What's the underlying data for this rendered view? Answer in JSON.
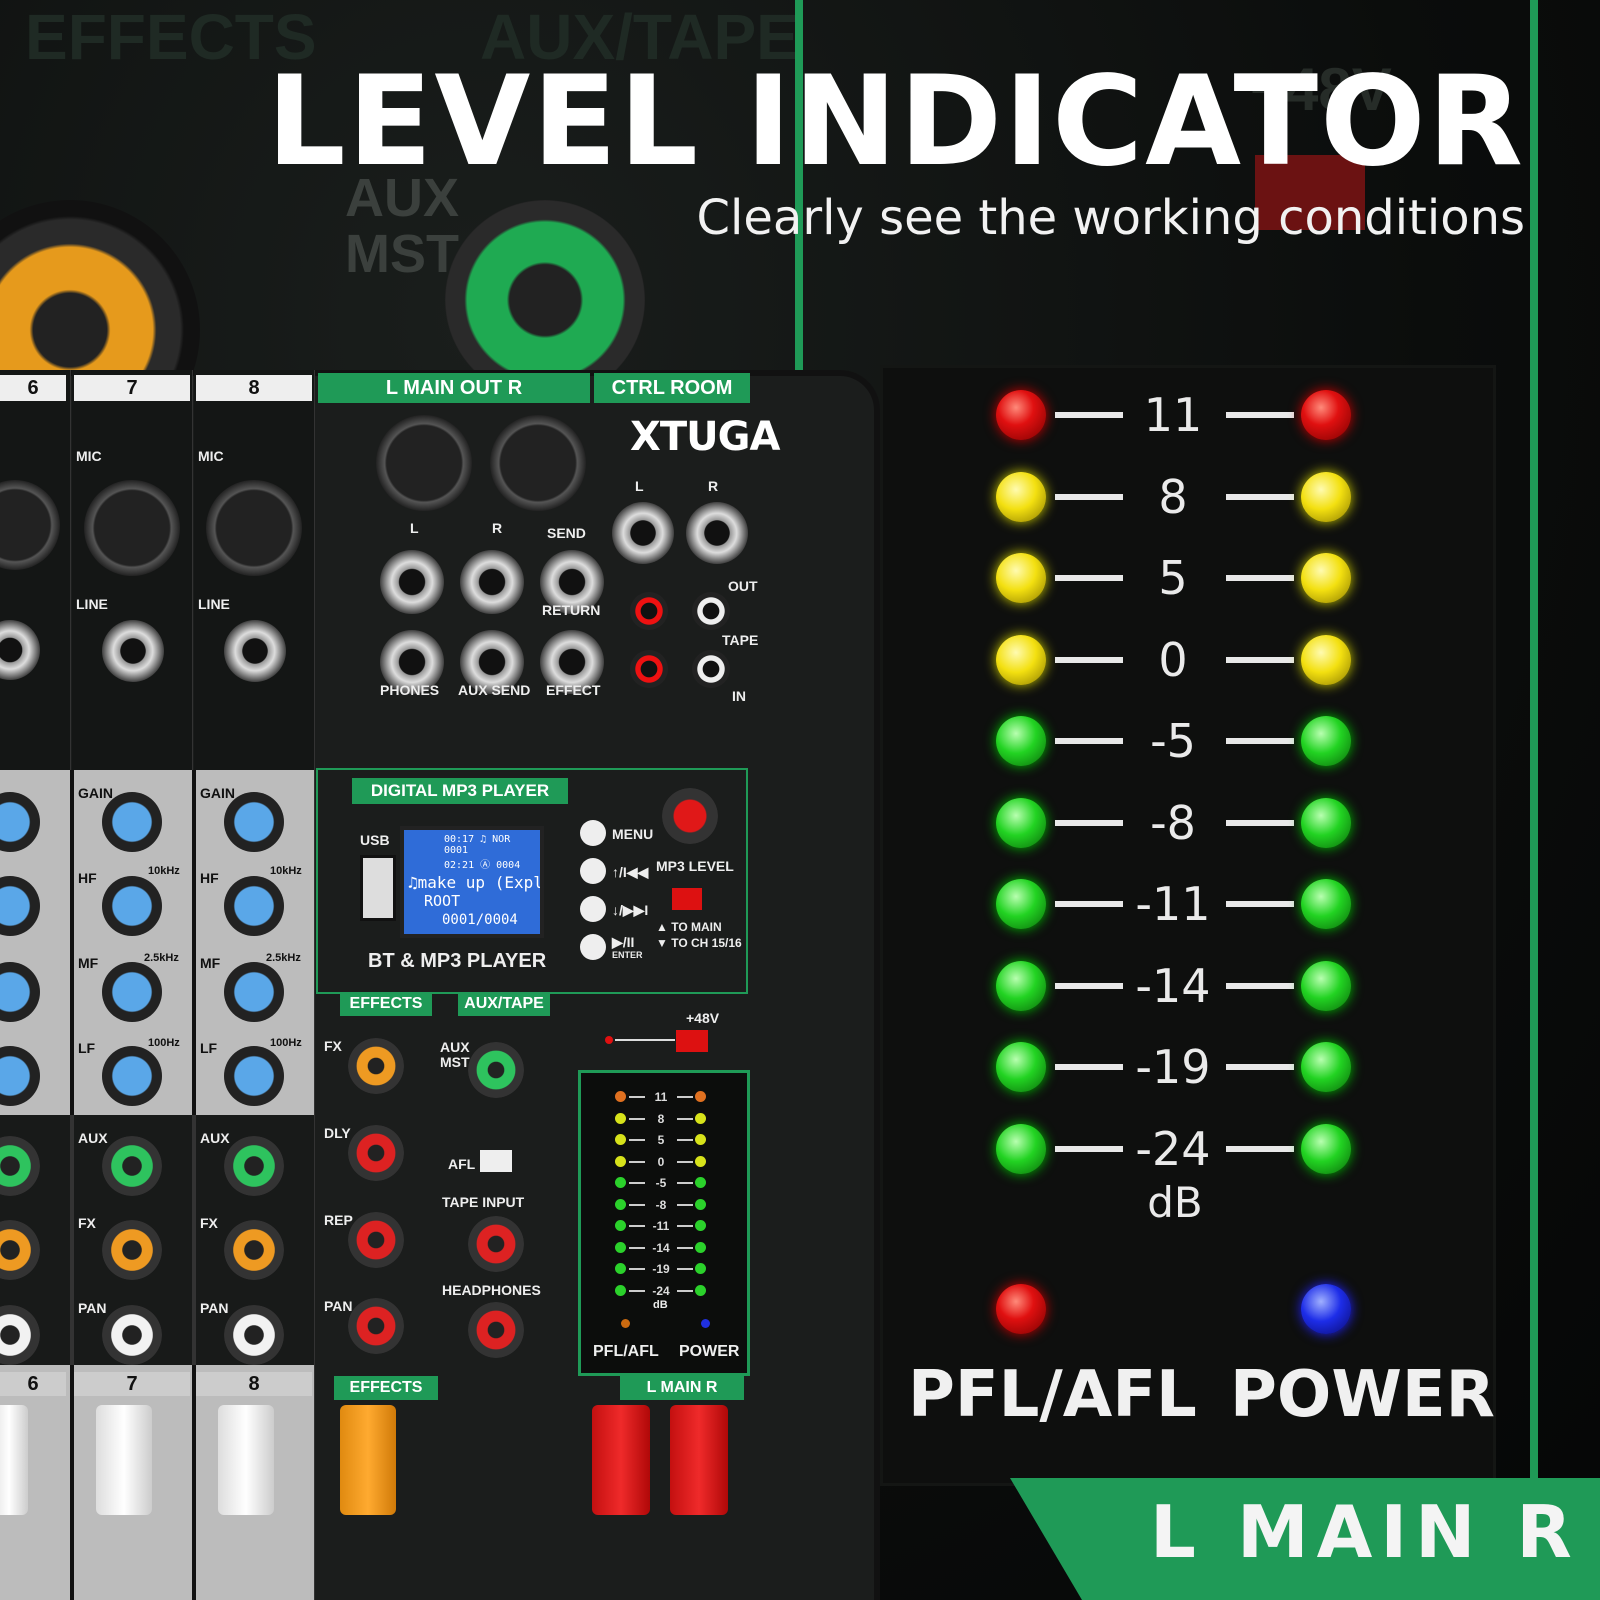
{
  "headline": "LEVEL INDICATOR",
  "subline": "Clearly see the working conditions",
  "background_text": {
    "effects": "EFFECTS",
    "aux_tape": "AUX/TAPE",
    "aux_mst": "AUX MST",
    "p48v": "+48V"
  },
  "mixer": {
    "channels": [
      "6",
      "7",
      "8"
    ],
    "main_out": "L  MAIN OUT  R",
    "ctrl_room": "CTRL ROOM",
    "brand": "XTUGA",
    "jack_labels": {
      "mic": "MIC",
      "line": "LINE",
      "l": "L",
      "r": "R",
      "send": "SEND",
      "return": "RETURN",
      "phones": "PHONES",
      "aux_send": "AUX SEND",
      "effect": "EFFECT",
      "out": "OUT",
      "tape": "TAPE",
      "in": "IN"
    },
    "mp3": {
      "title": "DIGITAL MP3 PLAYER",
      "usb": "USB",
      "lcd_line1": "00:17 ♫ NOR 0001",
      "lcd_line2": "02:21 Ⓐ 0004",
      "lcd_line3": "♫make up (Explic",
      "lcd_line4": "ROOT",
      "lcd_line5": "0001/0004",
      "bt_label": "BT & MP3 PLAYER",
      "menu": "MENU",
      "prev": "↑/I◀◀",
      "next": "↓/▶▶I",
      "play": "▶/II",
      "enter": "ENTER",
      "mp3_level": "MP3 LEVEL",
      "to_main": "▲ TO MAIN",
      "to_ch": "▼ TO CH 15/16"
    },
    "eq_labels": {
      "gain": "GAIN",
      "hf": "HF",
      "mf": "MF",
      "lf": "LF",
      "aux": "AUX",
      "fx": "FX",
      "pan": "PAN",
      "hz10k": "10kHz",
      "hz25k": "2.5kHz",
      "hz100": "100Hz"
    },
    "fx_section": {
      "effects": "EFFECTS",
      "aux_tape": "AUX/TAPE",
      "fx": "FX",
      "dly": "DLY",
      "rep": "REP",
      "pan": "PAN",
      "aux_mst": "AUX MST",
      "afl": "AFL",
      "tape_input": "TAPE INPUT",
      "headphones": "HEADPHONES",
      "p48v": "+48V",
      "pfl_afl": "PFL/AFL",
      "power": "POWER",
      "main": "L  MAIN  R",
      "effects_fader": "EFFECTS"
    }
  },
  "meter": {
    "levels": [
      "11",
      "8",
      "5",
      "0",
      "-5",
      "-8",
      "-11",
      "-14",
      "-19",
      "-24"
    ],
    "colors": [
      "red",
      "yellow",
      "yellow",
      "yellow",
      "green",
      "green",
      "green",
      "green",
      "green",
      "green"
    ],
    "unit": "dB",
    "pfl_afl_label": "PFL/AFL",
    "power_label": "POWER",
    "pfl_color": "#e01010",
    "power_color": "#1d2de8"
  },
  "main_bar": "L  MAIN  R",
  "accent_green": "#1f9a57"
}
